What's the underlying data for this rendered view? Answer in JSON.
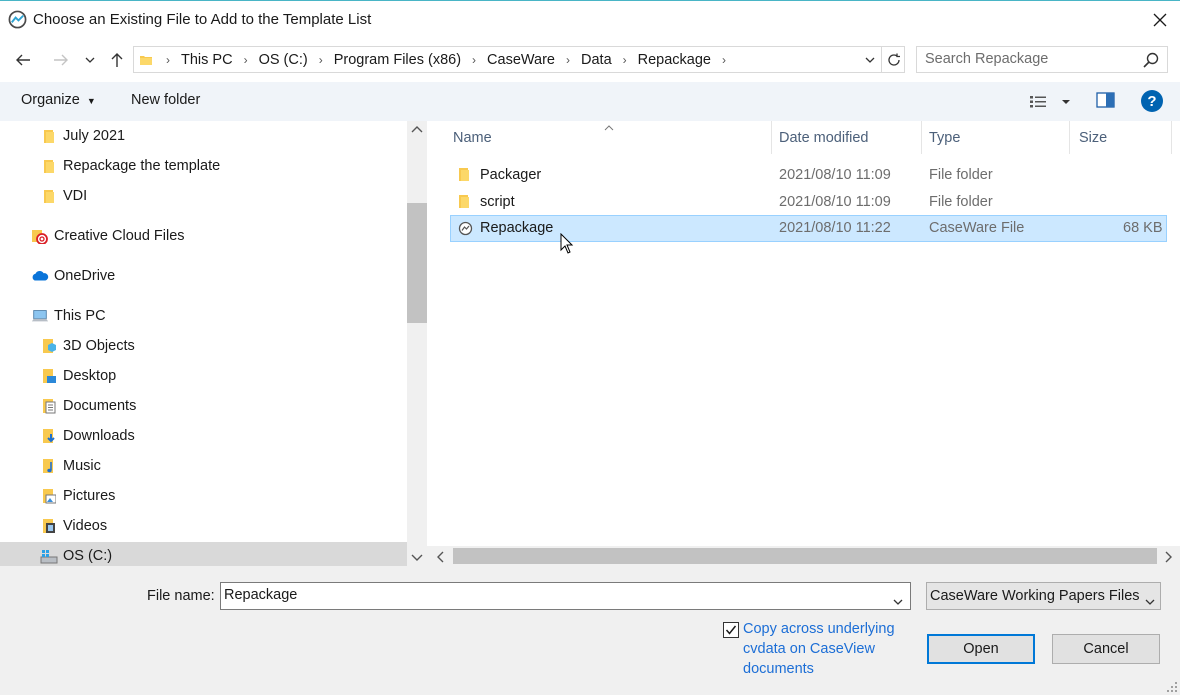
{
  "dialog": {
    "title": "Choose an Existing File to Add to the Template List"
  },
  "address": {
    "crumbs": [
      "This PC",
      "OS (C:)",
      "Program Files (x86)",
      "CaseWare",
      "Data",
      "Repackage"
    ]
  },
  "search": {
    "placeholder": "Search Repackage"
  },
  "toolbar": {
    "organize_label": "Organize",
    "new_folder_label": "New folder"
  },
  "tree": {
    "items": [
      {
        "label": "July 2021",
        "icon": "folder-icon"
      },
      {
        "label": "Repackage the template",
        "icon": "folder-icon"
      },
      {
        "label": "VDI",
        "icon": "folder-icon"
      },
      {
        "label": "Creative Cloud Files",
        "icon": "creative-cloud-icon"
      },
      {
        "label": "OneDrive",
        "icon": "onedrive-icon"
      },
      {
        "label": "This PC",
        "icon": "computer-icon"
      },
      {
        "label": "3D Objects",
        "icon": "3d-objects-icon"
      },
      {
        "label": "Desktop",
        "icon": "desktop-icon"
      },
      {
        "label": "Documents",
        "icon": "documents-icon"
      },
      {
        "label": "Downloads",
        "icon": "downloads-icon"
      },
      {
        "label": "Music",
        "icon": "music-icon"
      },
      {
        "label": "Pictures",
        "icon": "pictures-icon"
      },
      {
        "label": "Videos",
        "icon": "videos-icon"
      },
      {
        "label": "OS (C:)",
        "icon": "drive-icon"
      }
    ]
  },
  "files": {
    "columns": [
      "Name",
      "Date modified",
      "Type",
      "Size"
    ],
    "rows": [
      {
        "name": "Packager",
        "date": "2021/08/10 11:09",
        "type": "File folder",
        "size": ""
      },
      {
        "name": "script",
        "date": "2021/08/10 11:09",
        "type": "File folder",
        "size": ""
      },
      {
        "name": "Repackage",
        "date": "2021/08/10 11:22",
        "type": "CaseWare File",
        "size": "68 KB"
      }
    ]
  },
  "bottom": {
    "file_name_label": "File name:",
    "file_name_value": "Repackage",
    "file_type_value": "CaseWare Working Papers Files",
    "copy_checkbox_label": "Copy across underlying cvdata on CaseView documents",
    "copy_checked": true,
    "open_label": "Open",
    "cancel_label": "Cancel"
  },
  "colors": {
    "selection": "#cce8ff",
    "link": "#1c6ed6",
    "accent": "#0078d7",
    "help": "#0063b1",
    "folder": "#f8c94f"
  }
}
